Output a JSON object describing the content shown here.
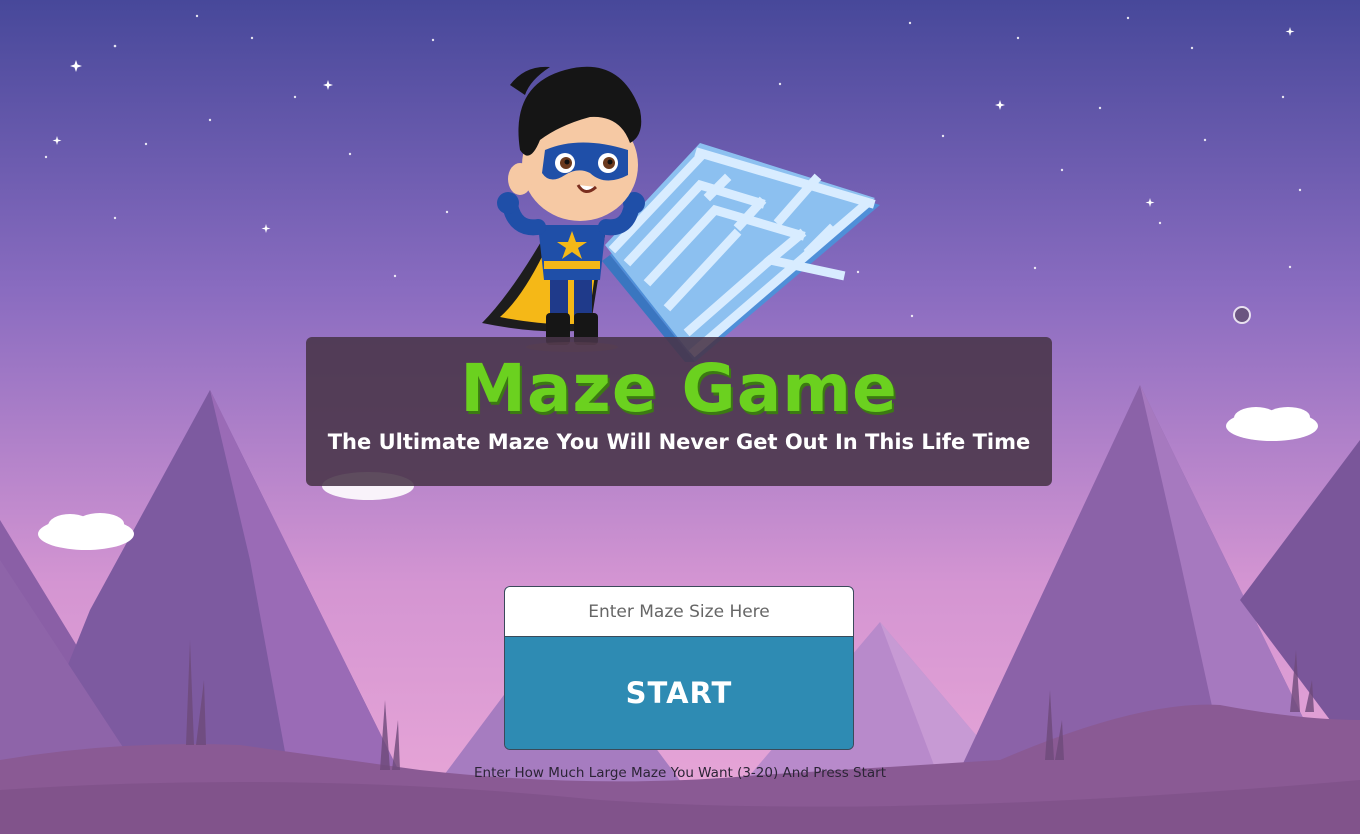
{
  "game": {
    "title": "Maze Game",
    "subtitle": "The Ultimate Maze You Will Never Get Out In This Life Time"
  },
  "form": {
    "input_placeholder": "Enter Maze Size Here",
    "input_value": "",
    "start_label": "START",
    "hint": "Enter How Much Large Maze You Want (3-20) And Press Start"
  },
  "colors": {
    "sky_top": "#4a4a9a",
    "sky_bottom": "#e4a6d6",
    "title_green": "#6bd11f",
    "start_button": "#2e8bb3",
    "title_panel": "#483448"
  },
  "icons": {
    "hero": "superhero-kid-illustration",
    "maze": "isometric-maze-icon",
    "cursor": "cursor-dot-icon"
  }
}
